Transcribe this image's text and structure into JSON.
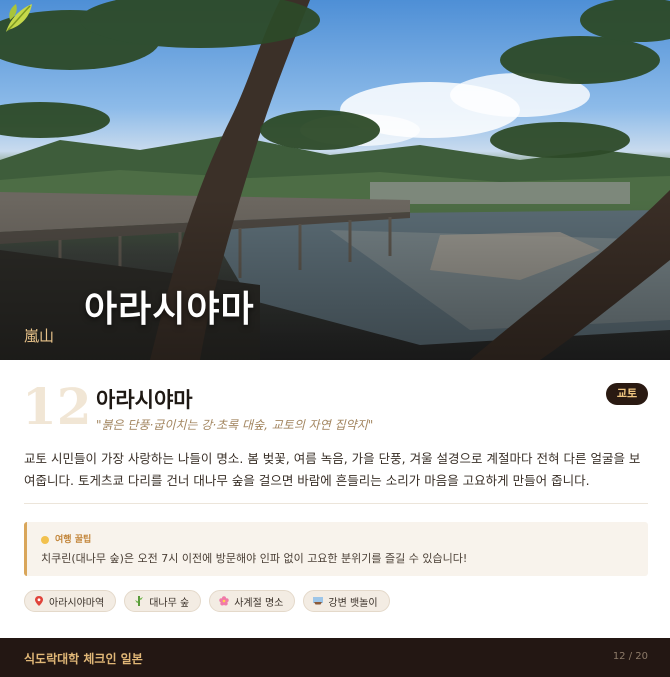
{
  "hero": {
    "title": "아라시야마",
    "kanji": "嵐山",
    "emblem_icon": "leaf-icon"
  },
  "card": {
    "number": "12",
    "title": "아라시야마",
    "quote": "\"붉은 단풍·굽이치는 강·초록 대숲, 교토의 자연 집약지\"",
    "badge": "교토",
    "description": "교토 시민들이 가장 사랑하는 나들이 명소. 봄 벚꽃, 여름 녹음, 가을 단풍, 겨울 설경으로 계절마다 전혀 다른 얼굴을 보여줍니다. 토게츠쿄 다리를 건너 대나무 숲을 걸으면 바람에 흔들리는 소리가 마음을 고요하게 만들어 줍니다."
  },
  "tip": {
    "label": "여행 꿀팁",
    "icon": "lightbulb-icon",
    "text": "치쿠린(대나무 숲)은 오전 7시 이전에 방문해야 인파 없이 고요한 분위기를 즐길 수 있습니다!"
  },
  "tags": [
    {
      "icon": "pin-icon",
      "label": "아라시야마역"
    },
    {
      "icon": "bamboo-icon",
      "label": "대나무 숲"
    },
    {
      "icon": "blossom-icon",
      "label": "사계절 명소"
    },
    {
      "icon": "boat-icon",
      "label": "강변 뱃놀이"
    }
  ],
  "footer": {
    "brand": "식도락대학 체크인 일본",
    "page": "12 / 20"
  },
  "colors": {
    "accent": "#d9a65a",
    "badge_bg": "#2a1a12",
    "footer_bg": "#231713"
  }
}
